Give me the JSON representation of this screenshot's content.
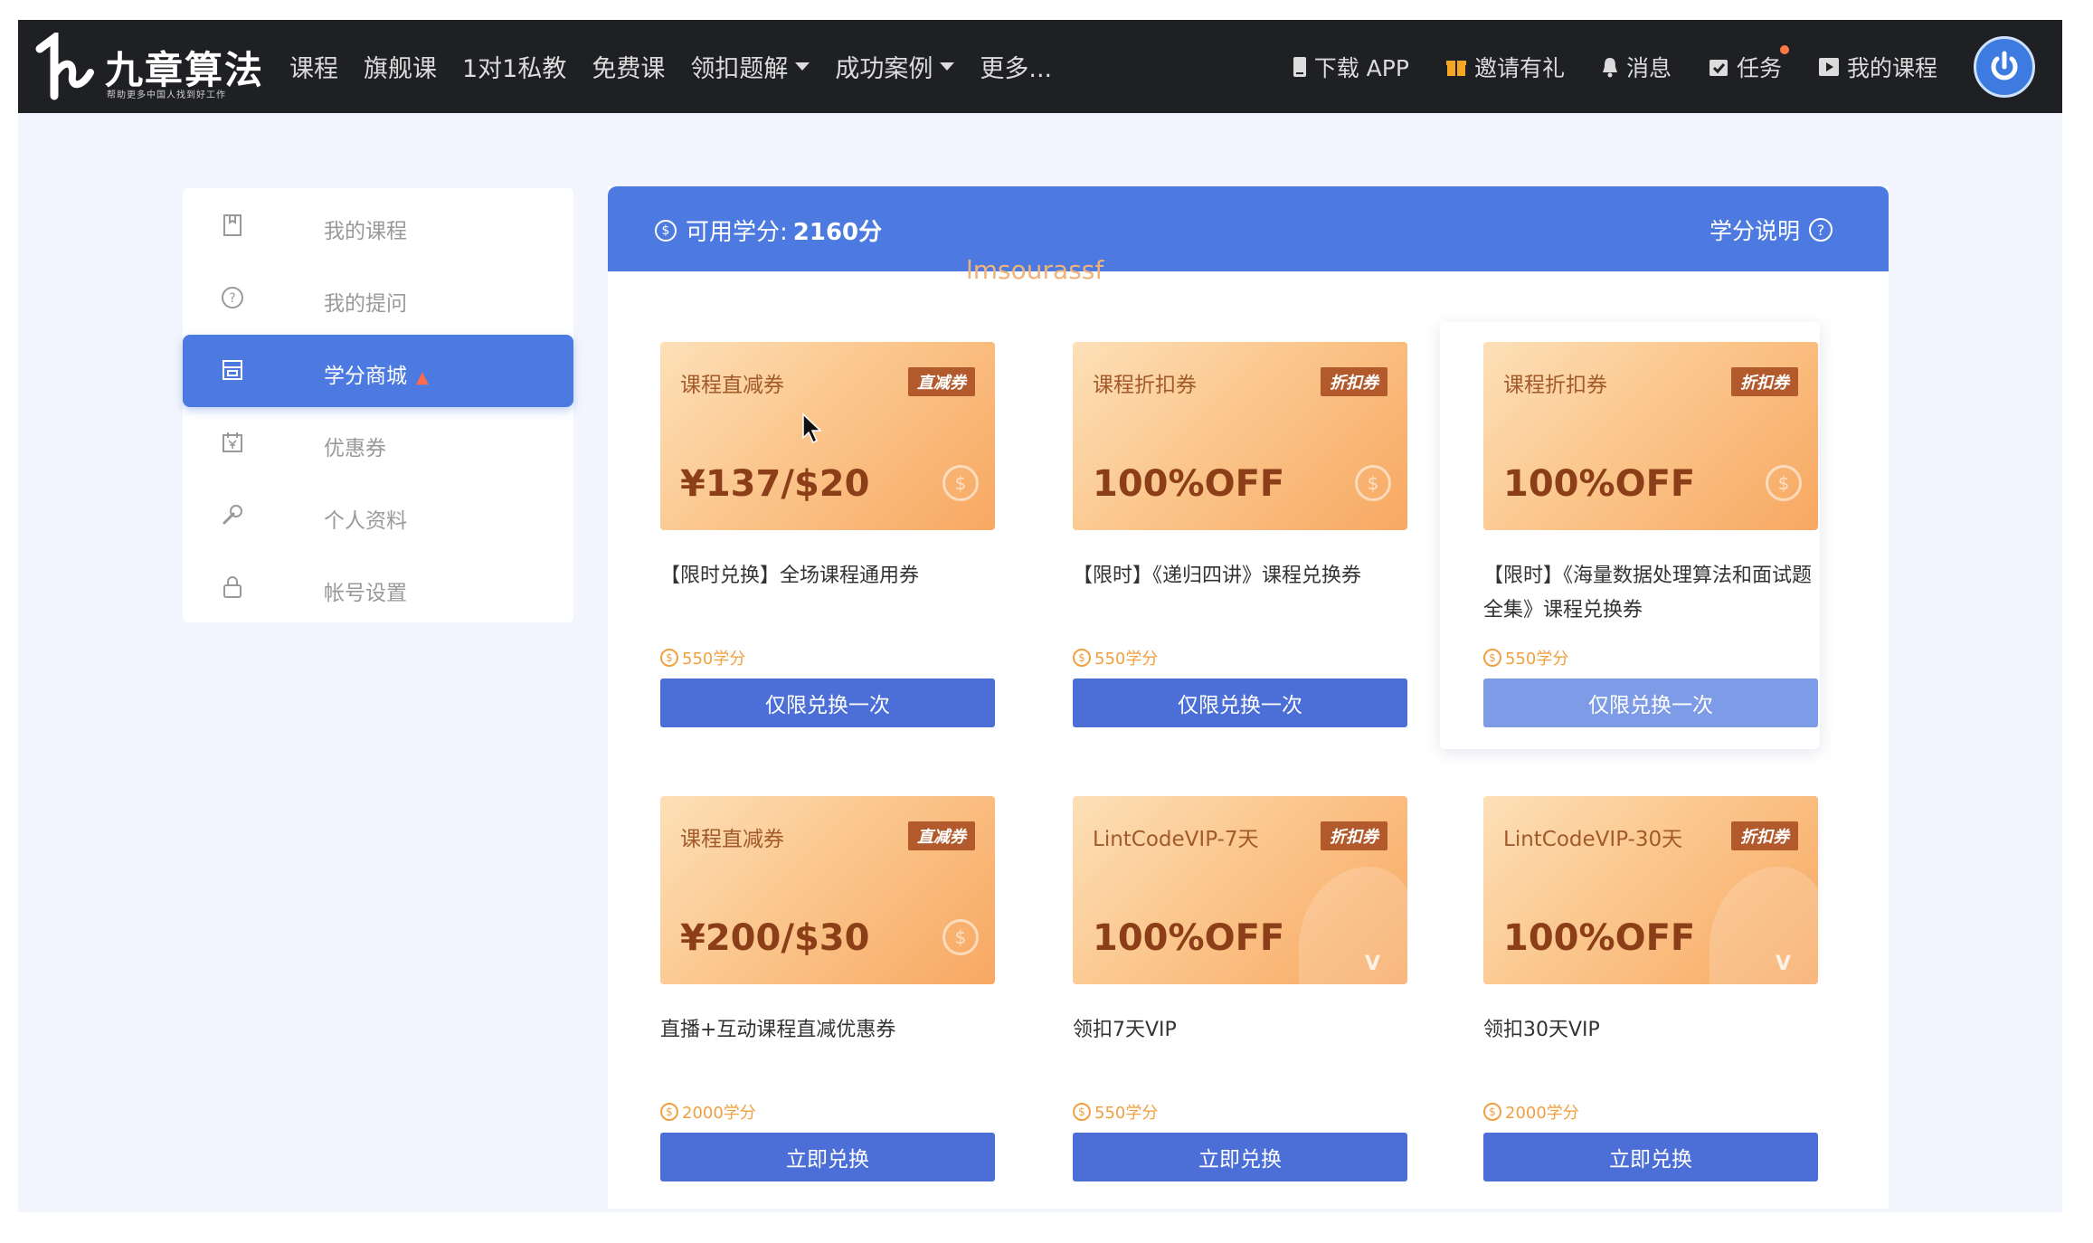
{
  "app": {
    "logo_title": "九章算法",
    "logo_subtitle": "帮助更多中国人找到好工作"
  },
  "nav": {
    "links": [
      {
        "label": "课程"
      },
      {
        "label": "旗舰课"
      },
      {
        "label": "1对1私教"
      },
      {
        "label": "免费课"
      },
      {
        "label": "领扣题解",
        "dropdown": true
      },
      {
        "label": "成功案例",
        "dropdown": true
      },
      {
        "label": "更多..."
      }
    ],
    "right": {
      "download": "下载 APP",
      "invite": "邀请有礼",
      "messages": "消息",
      "tasks": "任务",
      "my_courses": "我的课程"
    }
  },
  "sidebar": {
    "items": [
      {
        "label": "我的课程",
        "icon": "bookmark-icon"
      },
      {
        "label": "我的提问",
        "icon": "question-icon"
      },
      {
        "label": "学分商城",
        "icon": "store-icon",
        "active": true
      },
      {
        "label": "优惠券",
        "icon": "coupon-icon"
      },
      {
        "label": "个人资料",
        "icon": "wrench-icon"
      },
      {
        "label": "帐号设置",
        "icon": "lock-icon"
      }
    ]
  },
  "banner": {
    "credit_label": "可用学分:",
    "credit_value": "2160分",
    "explain_label": "学分说明",
    "watermark": "lmsourassf"
  },
  "cards": [
    {
      "type": "课程直减券",
      "tag": "直减券",
      "value": "¥137/$20",
      "title": "【限时兑换】全场课程通用券",
      "price": "550学分",
      "button": "仅限兑换一次"
    },
    {
      "type": "课程折扣券",
      "tag": "折扣券",
      "value": "100%OFF",
      "title": "【限时】《递归四讲》课程兑换券",
      "price": "550学分",
      "button": "仅限兑换一次"
    },
    {
      "type": "课程折扣券",
      "tag": "折扣券",
      "value": "100%OFF",
      "title": "【限时】《海量数据处理算法和面试题全集》课程兑换券",
      "price": "550学分",
      "button": "仅限兑换一次"
    },
    {
      "type": "课程直减券",
      "tag": "直减券",
      "value": "¥200/$30",
      "title": "直播+互动课程直减优惠券",
      "price": "2000学分",
      "button": "立即兑换"
    },
    {
      "type": "LintCodeVIP-7天",
      "tag": "折扣券",
      "value": "100%OFF",
      "title": "领扣7天VIP",
      "price": "550学分",
      "button": "立即兑换"
    },
    {
      "type": "LintCodeVIP-30天",
      "tag": "折扣券",
      "value": "100%OFF",
      "title": "领扣30天VIP",
      "price": "2000学分",
      "button": "立即兑换"
    }
  ],
  "colors": {
    "nav_bg": "#1f2023",
    "accent": "#4c7ae0",
    "button": "#4c6fd7",
    "page_bg": "#f2f5fd",
    "coupon_text": "#8b3e18",
    "credit_orange": "#f0a040"
  }
}
